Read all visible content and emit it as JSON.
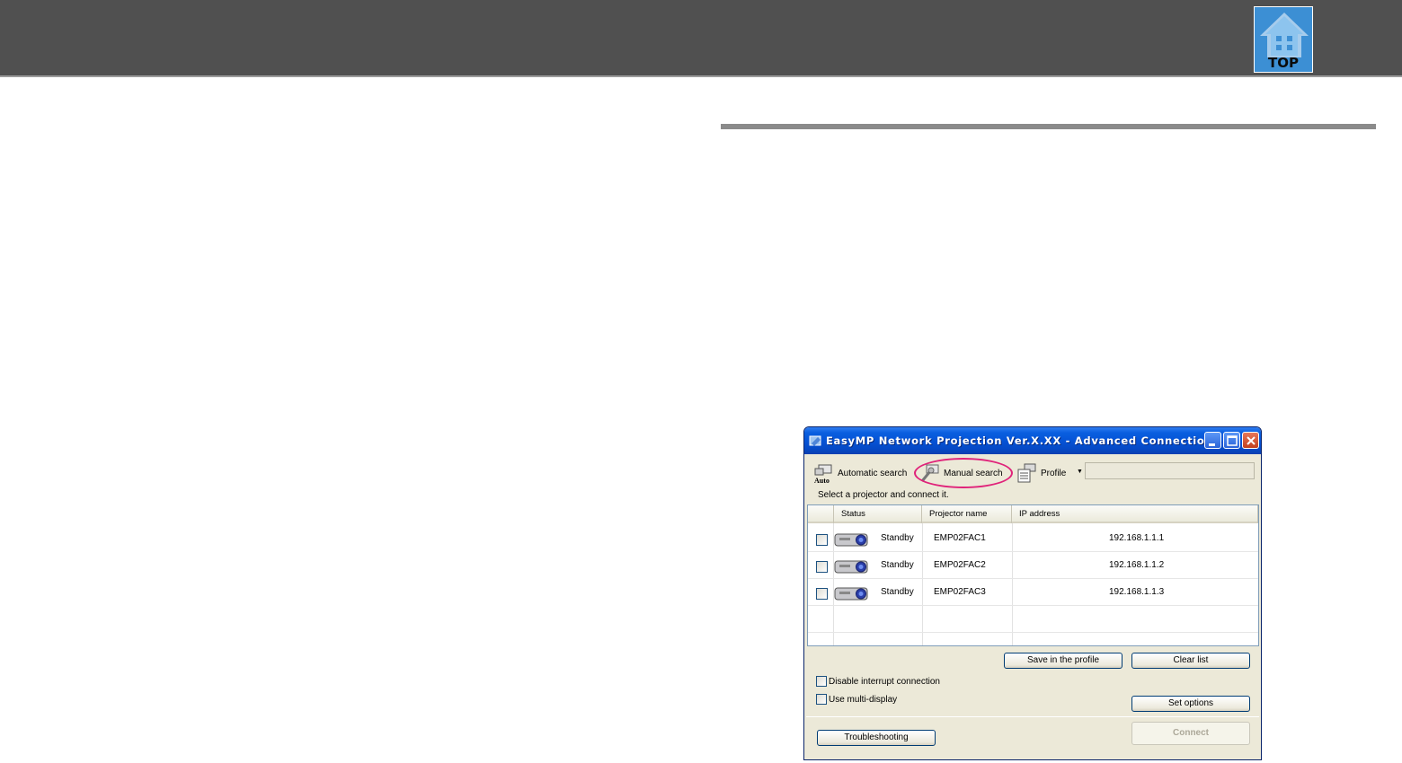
{
  "header": {
    "top_label": "TOP"
  },
  "window": {
    "title": "EasyMP Network Projection Ver.X.XX - Advanced Connection -",
    "toolbar": {
      "automatic_search": "Automatic search",
      "manual_search": "Manual search",
      "profile": "Profile",
      "auto_icon_text": "Auto"
    },
    "instruction": "Select a projector and connect it.",
    "columns": [
      "Status",
      "Projector name",
      "IP address"
    ],
    "rows": [
      {
        "status": "Standby",
        "name": "EMP02FAC1",
        "ip": "192.168.1.1.1"
      },
      {
        "status": "Standby",
        "name": "EMP02FAC2",
        "ip": "192.168.1.1.2"
      },
      {
        "status": "Standby",
        "name": "EMP02FAC3",
        "ip": "192.168.1.1.3"
      }
    ],
    "buttons": {
      "save_profile": "Save in the profile",
      "clear_list": "Clear list",
      "set_options": "Set options",
      "troubleshooting": "Troubleshooting",
      "connect": "Connect"
    },
    "options": {
      "disable_interrupt": "Disable interrupt connection",
      "multi_display": "Use multi-display"
    }
  },
  "colors": {
    "header_bar": "#505050",
    "top_badge": "#3c8fd4",
    "highlight_ring": "#e0237a",
    "titlebar": "#0553d6"
  },
  "icons": [
    "home-icon",
    "app-icon",
    "minimize-icon",
    "maximize-icon",
    "close-icon",
    "auto-search-icon",
    "manual-search-icon",
    "profile-icon",
    "projector-icon"
  ]
}
